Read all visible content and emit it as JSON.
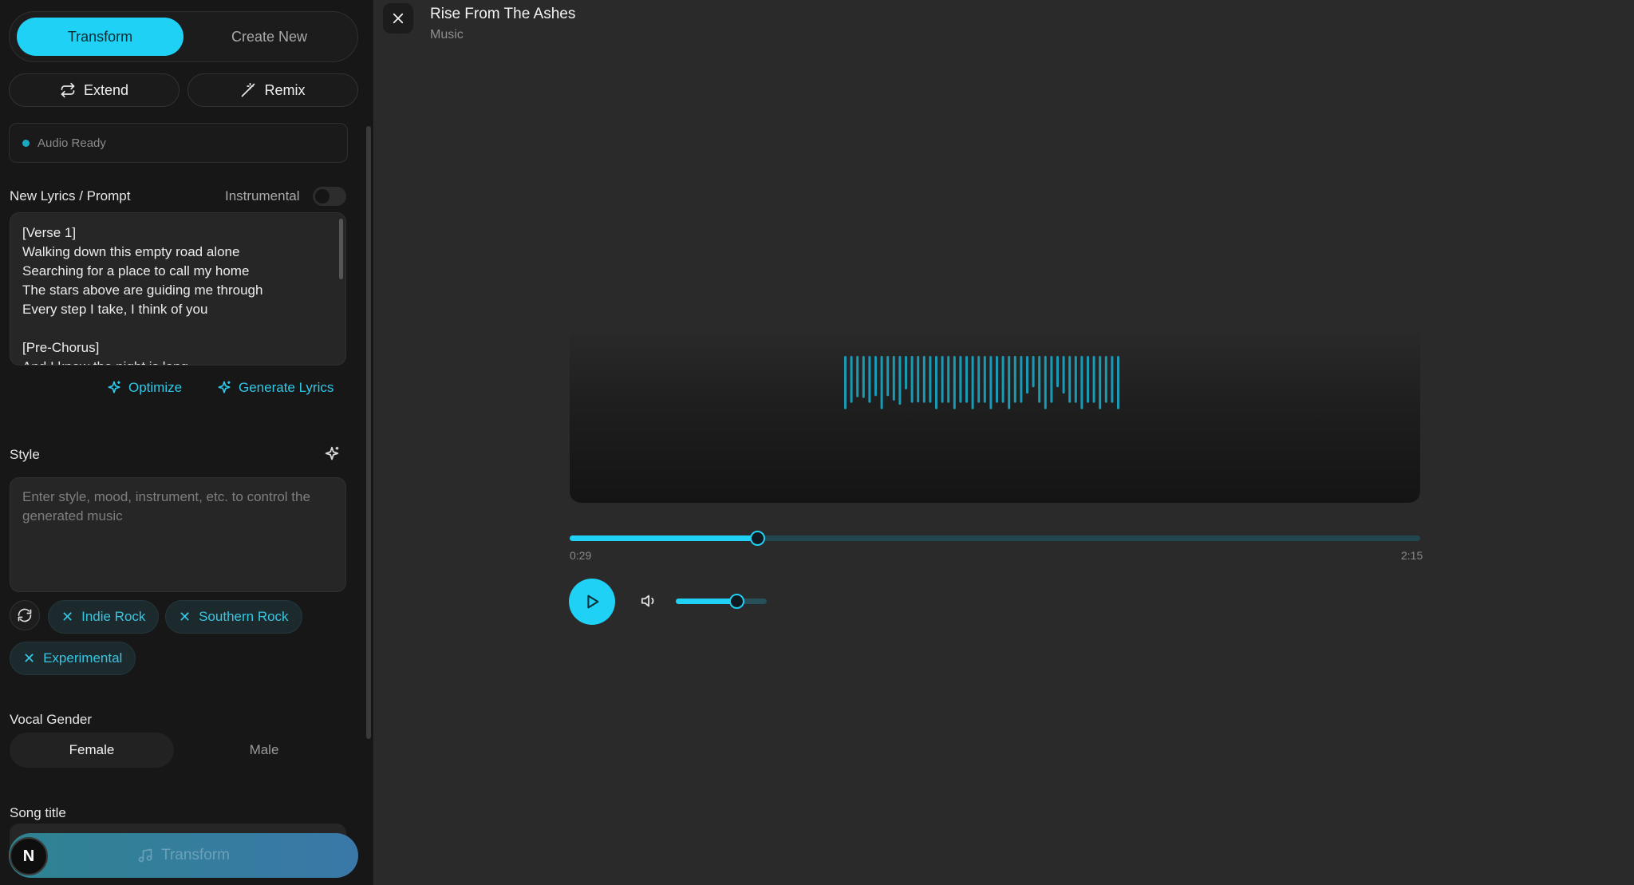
{
  "sidebar": {
    "mode_tabs": [
      {
        "label": "Transform",
        "active": true
      },
      {
        "label": "Create New",
        "active": false
      }
    ],
    "actions": {
      "extend_label": "Extend",
      "remix_label": "Remix"
    },
    "status_text": "Audio Ready",
    "lyrics": {
      "label": "New Lyrics / Prompt",
      "instrumental_label": "Instrumental",
      "instrumental_on": false,
      "text": "[Verse 1]\nWalking down this empty road alone\nSearching for a place to call my home\nThe stars above are guiding me through\nEvery step I take, I think of you\n\n[Pre-Chorus]\nAnd I know the night is long",
      "optimize_label": "Optimize",
      "generate_label": "Generate Lyrics"
    },
    "style": {
      "label": "Style",
      "placeholder": "Enter style, mood, instrument, etc. to control the generated music",
      "tags": [
        "Indie Rock",
        "Southern Rock",
        "Experimental"
      ]
    },
    "vocal": {
      "label": "Vocal Gender",
      "options": [
        "Female",
        "Male"
      ],
      "selected": "Female"
    },
    "song_title_label": "Song title",
    "transform_button": "Transform",
    "avatar_initial": "N"
  },
  "player": {
    "title": "Rise From The Ashes",
    "subtitle": "Music",
    "current_time": "0:29",
    "total_time": "2:15",
    "progress": 0.22,
    "volume": 0.67,
    "waveform": [
      0.42,
      0.42,
      0.37,
      0.32,
      0.42,
      0.36,
      0.42,
      0.36,
      0.4,
      0.38,
      0.3,
      0.42,
      0.36,
      0.42,
      0.42,
      0.42,
      0.42,
      0.42,
      0.42,
      0.42,
      0.42,
      0.42,
      0.42,
      0.42,
      0.42,
      0.42,
      0.42,
      0.42,
      0.42,
      0.42,
      0.28,
      0.28,
      0.42,
      0.42,
      0.42,
      0.28,
      0.28,
      0.42,
      0.42,
      0.42,
      0.42,
      0.42,
      0.42,
      0.42,
      0.42,
      0.42
    ],
    "waveform_colors": {
      "bar": "#1c9ab4"
    }
  }
}
